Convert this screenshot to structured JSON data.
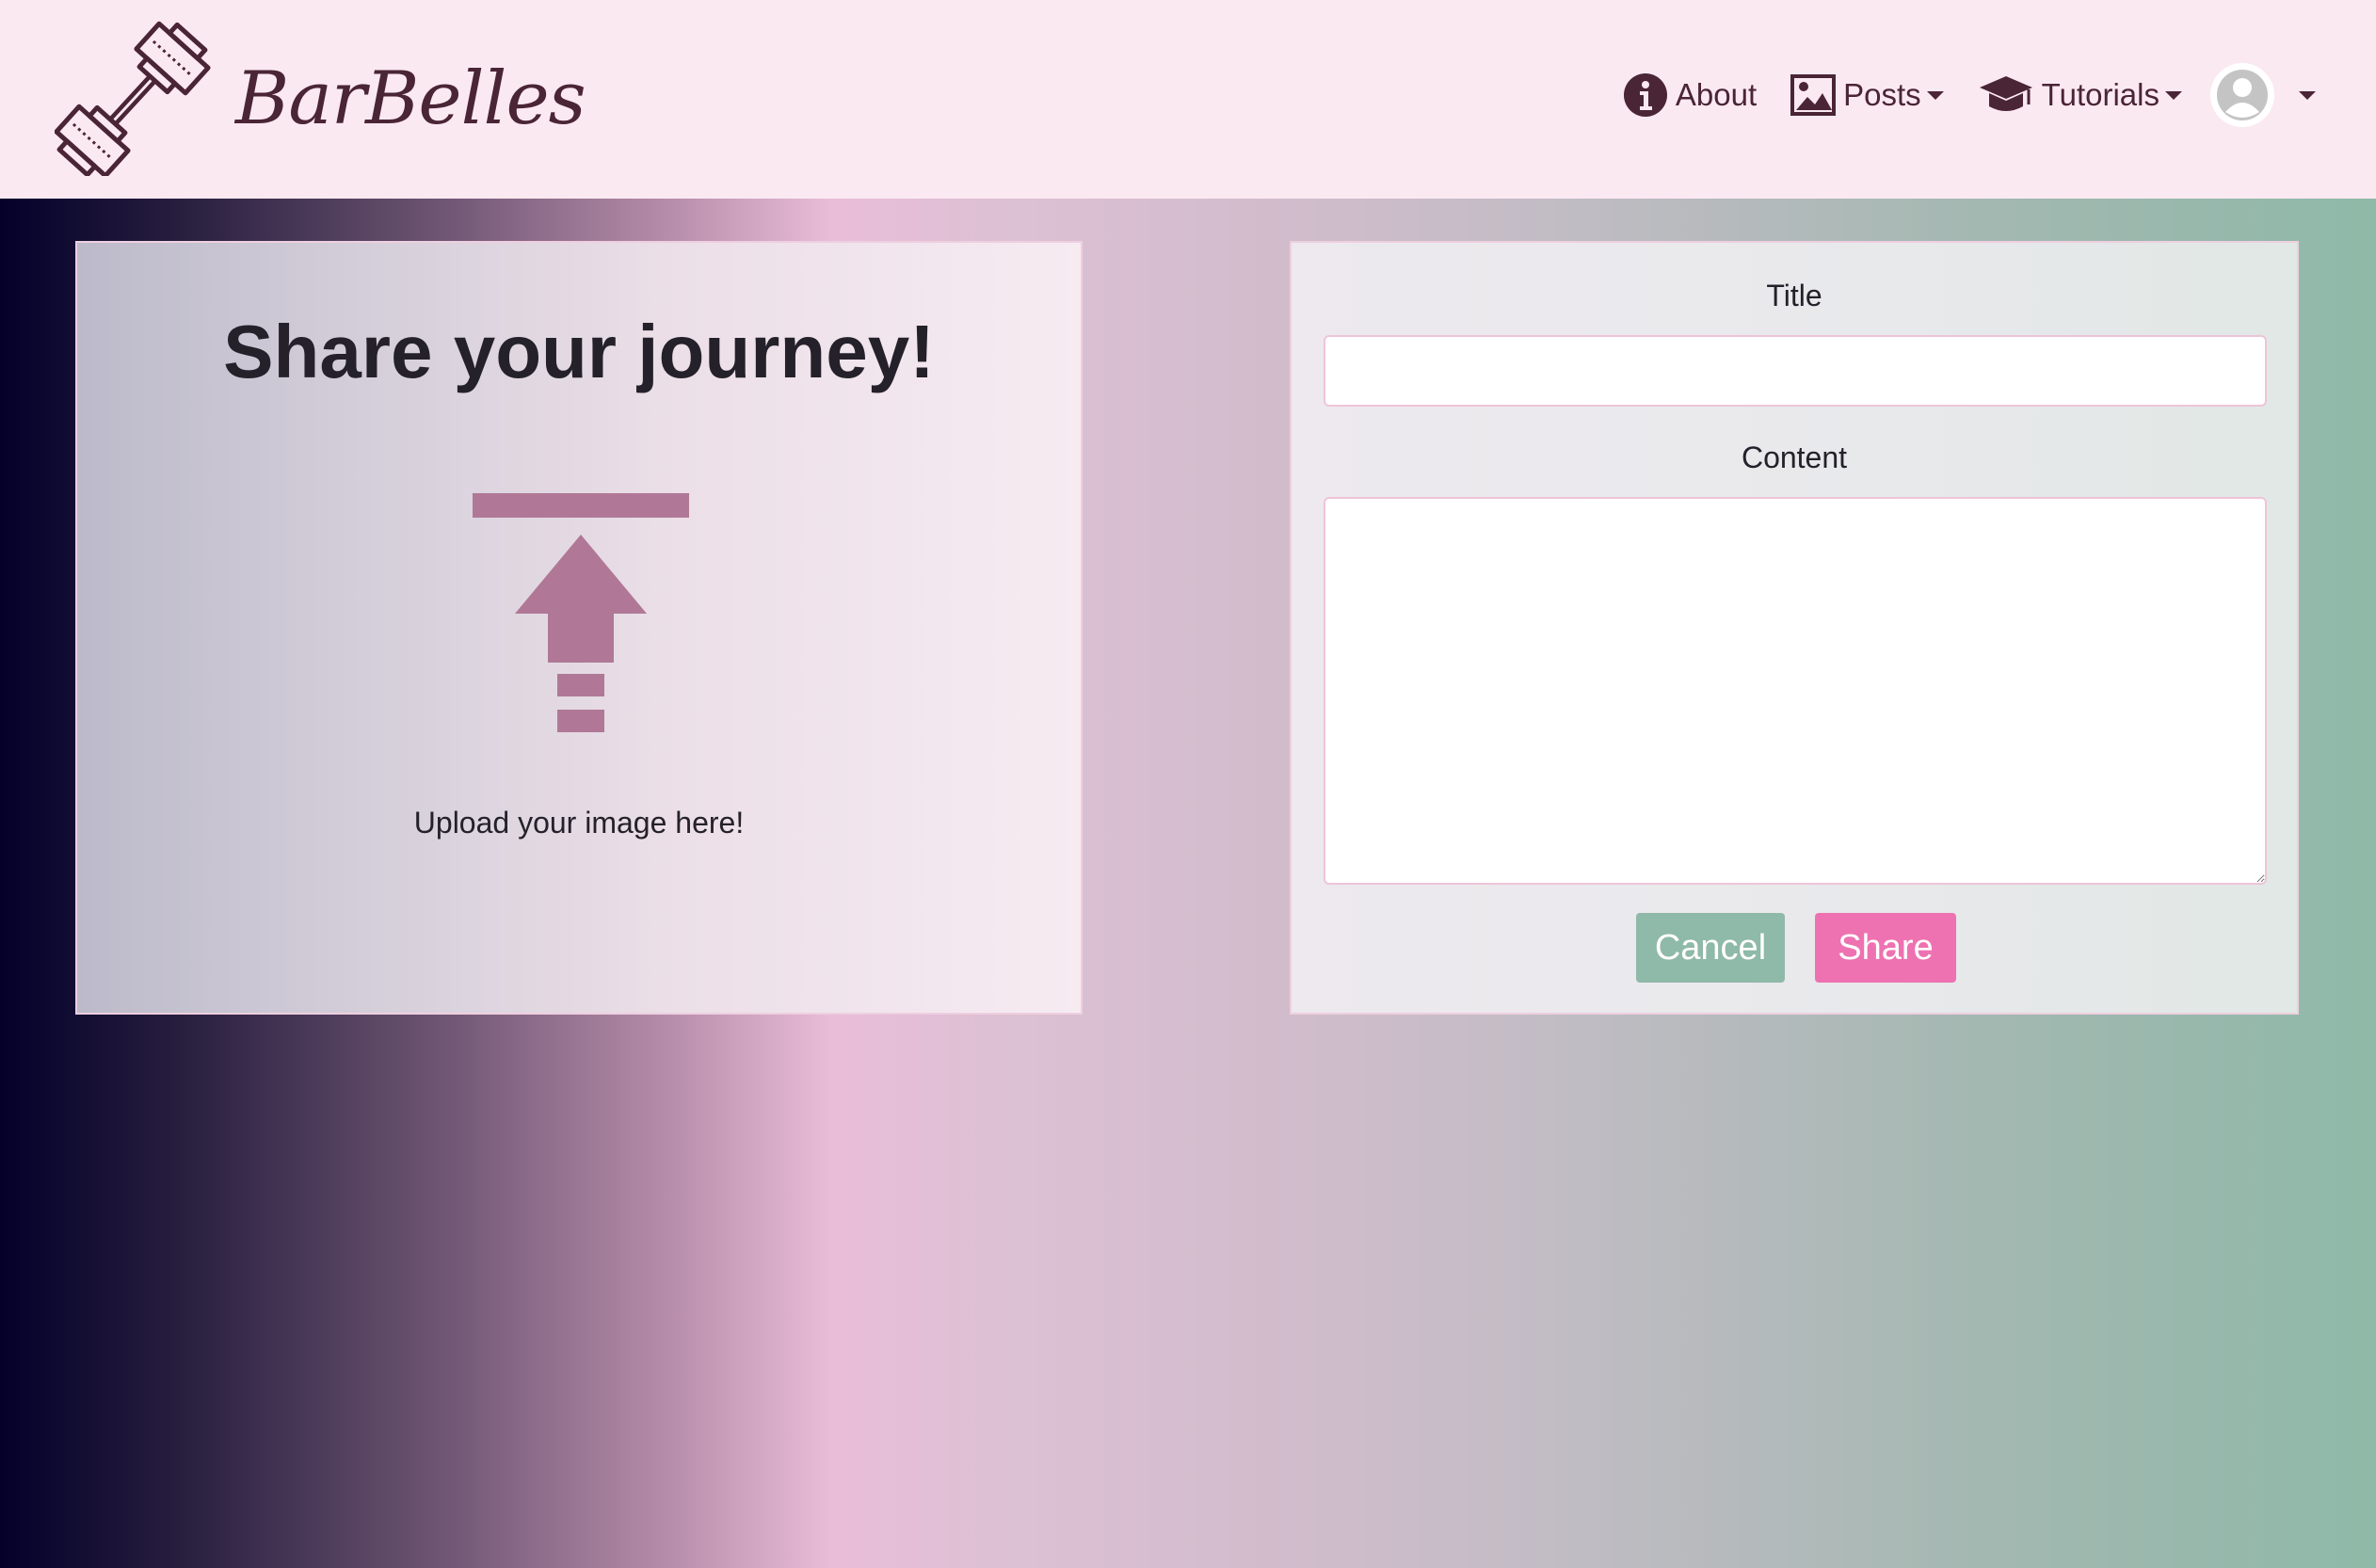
{
  "brand": {
    "name": "BarBelles"
  },
  "nav": {
    "about": "About",
    "posts": "Posts",
    "tutorials": "Tutorials"
  },
  "upload_panel": {
    "heading": "Share your journey!",
    "label": "Upload your image here!"
  },
  "form": {
    "title_label": "Title",
    "title_value": "",
    "content_label": "Content",
    "content_value": "",
    "cancel_label": "Cancel",
    "share_label": "Share"
  },
  "colors": {
    "navbar_bg": "#fbe9f1",
    "brand_text": "#4a2535",
    "upload_icon": "#b07896",
    "cancel_button": "#8fb9a8",
    "share_button": "#ee72b1",
    "input_border": "#eec4d8"
  },
  "icons": {
    "logo": "dumbbell-icon",
    "about": "info-circle-icon",
    "posts": "image-icon",
    "tutorials": "graduation-cap-icon",
    "avatar": "user-avatar-icon",
    "upload": "upload-arrow-icon"
  }
}
